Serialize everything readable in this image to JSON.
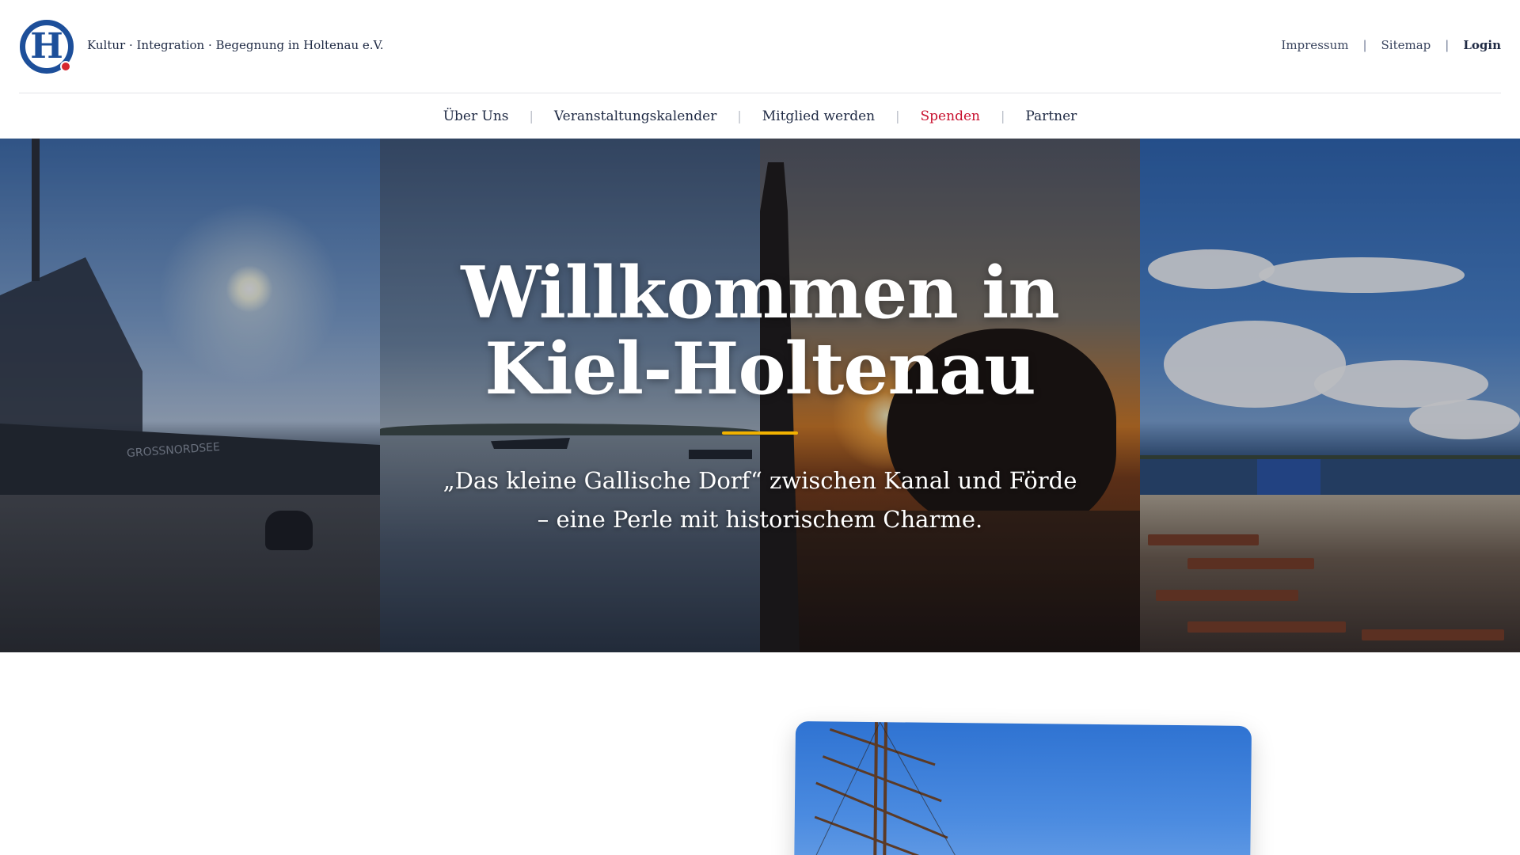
{
  "header": {
    "logo_letter": "H",
    "org_name": "Kultur · Integration · Begegnung in Holtenau e.V.",
    "util_links": [
      {
        "label": "Impressum"
      },
      {
        "label": "Sitemap"
      },
      {
        "label": "Login"
      }
    ],
    "util_separator": "|"
  },
  "nav": {
    "items": [
      {
        "label": "Über Uns"
      },
      {
        "label": "Veranstaltungskalender"
      },
      {
        "label": "Mitglied werden"
      },
      {
        "label": "Spenden"
      },
      {
        "label": "Partner"
      }
    ],
    "separator": "|",
    "accent_color": "#c8102e"
  },
  "hero": {
    "title_line1": "Willkommen in",
    "title_line2": "Kiel-Holtenau",
    "subtitle_line1": "„Das kleine Gallische Dorf“ zwischen Kanal und Förde",
    "subtitle_line2": "– eine Perle mit historischem Charme.",
    "rule_color": "#f2b200",
    "ship_text": "GROSSNORDSEE"
  },
  "colors": {
    "brand_blue": "#1d4f9a",
    "text_dark": "#1f2a44",
    "accent_red": "#c8102e"
  }
}
